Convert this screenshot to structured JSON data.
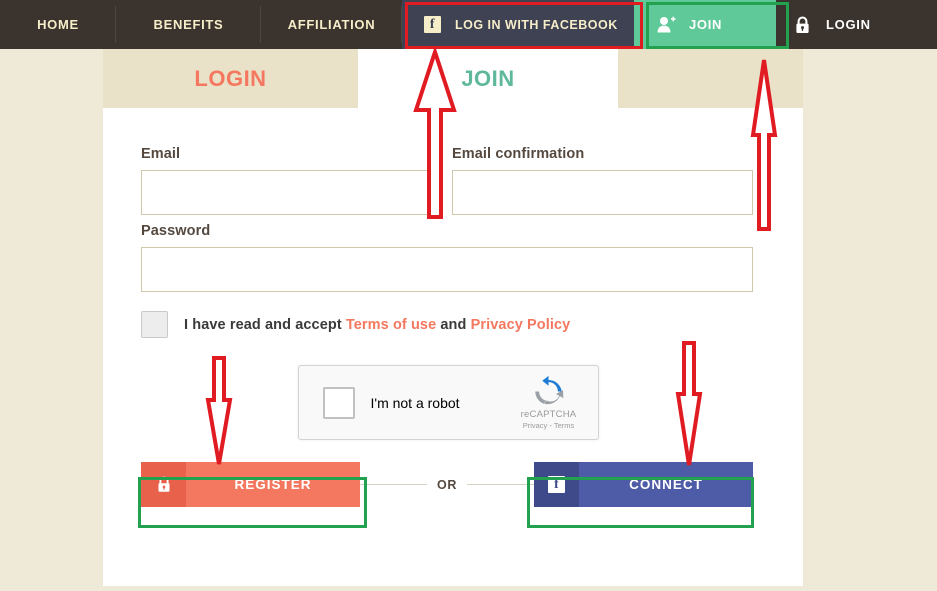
{
  "nav": {
    "items": [
      {
        "label": "HOME",
        "name": "nav-item-home"
      },
      {
        "label": "BENEFITS",
        "name": "nav-item-benefits"
      },
      {
        "label": "AFFILIATION",
        "name": "nav-item-affiliation"
      }
    ],
    "facebook_login": {
      "label": "LOG IN WITH FACEBOOK",
      "icon": "facebook-icon"
    },
    "join": {
      "label": "JOIN",
      "icon": "user-plus-icon"
    },
    "login": {
      "label": "LOGIN",
      "icon": "lock-icon"
    }
  },
  "tabs": {
    "login": "LOGIN",
    "join": "JOIN",
    "active": "JOIN"
  },
  "form": {
    "email": {
      "label": "Email",
      "value": "",
      "placeholder": ""
    },
    "email_confirmation": {
      "label": "Email confirmation",
      "value": "",
      "placeholder": ""
    },
    "password": {
      "label": "Password",
      "value": "",
      "placeholder": ""
    },
    "terms": {
      "checked": false,
      "prefix": "I have read and accept ",
      "terms_link": "Terms of use",
      "conjunction": " and ",
      "privacy_link": "Privacy Policy"
    },
    "captcha": {
      "label": "I'm not a robot",
      "brand": "reCAPTCHA",
      "legal": "Privacy - Terms",
      "checked": false
    },
    "register_button": {
      "label": "REGISTER",
      "icon": "lock-icon"
    },
    "separator": "OR",
    "connect_button": {
      "label": "CONNECT",
      "icon": "facebook-icon"
    }
  },
  "colors": {
    "nav_bg": "#3b332d",
    "nav_text": "#f6edc9",
    "facebook_nav_bg": "#3e4253",
    "join_green": "#5fc99a",
    "page_bg": "#efe9d7",
    "tab_inactive_bg": "#e9e2c9",
    "tab_login_text": "#f4785f",
    "tab_join_text": "#5fb89c",
    "accent_salmon": "#f4785f",
    "facebook_blue": "#4e5ba6",
    "highlight_red": "#e11b22",
    "highlight_green": "#22a14e",
    "input_border": "#cfc8ab",
    "label_text": "#55493f"
  },
  "annotations": {
    "highlight_facebook_nav": "red",
    "highlight_join_nav": "green",
    "highlight_register_button": "green",
    "highlight_connect_button": "green",
    "arrows": [
      {
        "name": "arrow-up-to-facebook-login",
        "direction": "up"
      },
      {
        "name": "arrow-up-to-join-nav",
        "direction": "up"
      },
      {
        "name": "arrow-down-to-register-button",
        "direction": "down"
      },
      {
        "name": "arrow-down-to-connect-button",
        "direction": "down"
      }
    ]
  }
}
